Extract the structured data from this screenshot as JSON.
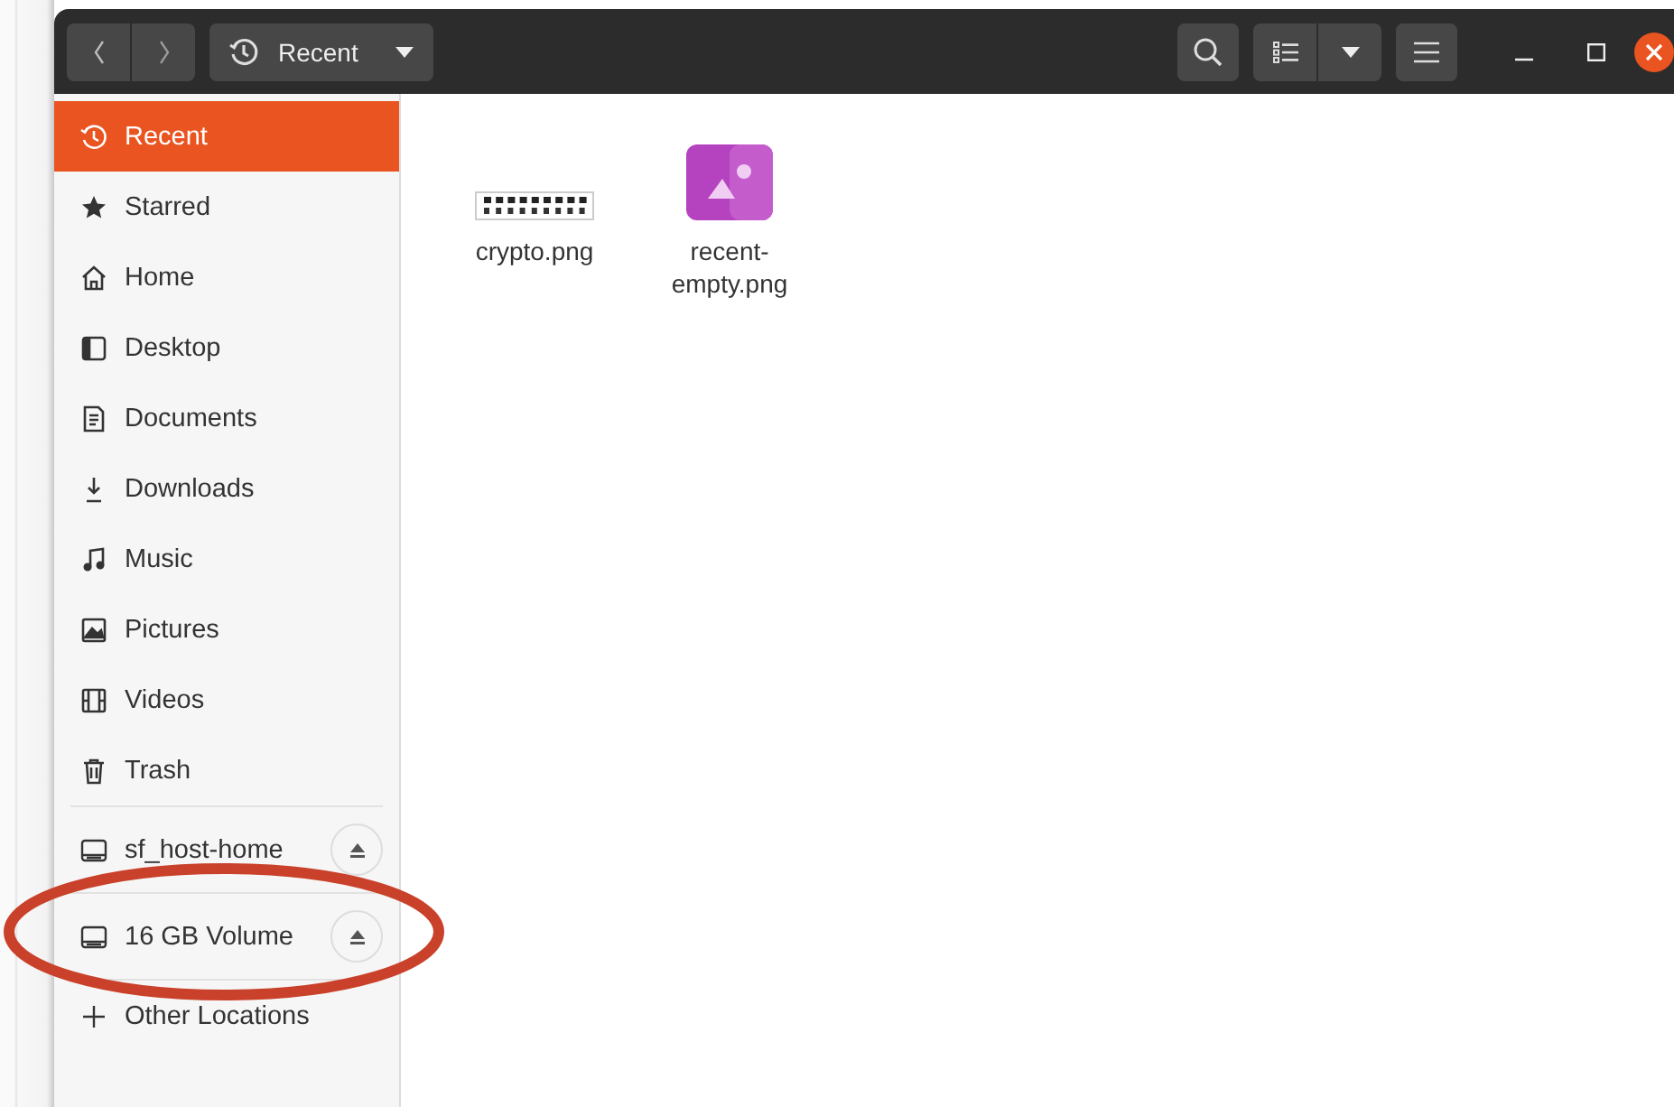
{
  "header": {
    "location": "Recent"
  },
  "sidebar": {
    "places": [
      {
        "label": "Recent",
        "selected": true
      },
      {
        "label": "Starred",
        "selected": false
      },
      {
        "label": "Home",
        "selected": false
      },
      {
        "label": "Desktop",
        "selected": false
      },
      {
        "label": "Documents",
        "selected": false
      },
      {
        "label": "Downloads",
        "selected": false
      },
      {
        "label": "Music",
        "selected": false
      },
      {
        "label": "Pictures",
        "selected": false
      },
      {
        "label": "Videos",
        "selected": false
      },
      {
        "label": "Trash",
        "selected": false
      }
    ],
    "mounts": [
      {
        "label": "sf_host-home",
        "selected": false
      },
      {
        "label": "16 GB Volume",
        "selected": false
      }
    ],
    "other": {
      "label": "Other Locations"
    }
  },
  "files": [
    {
      "name": "crypto.png",
      "kind": "text-image"
    },
    {
      "name": "recent-empty.png",
      "kind": "image-icon"
    }
  ]
}
